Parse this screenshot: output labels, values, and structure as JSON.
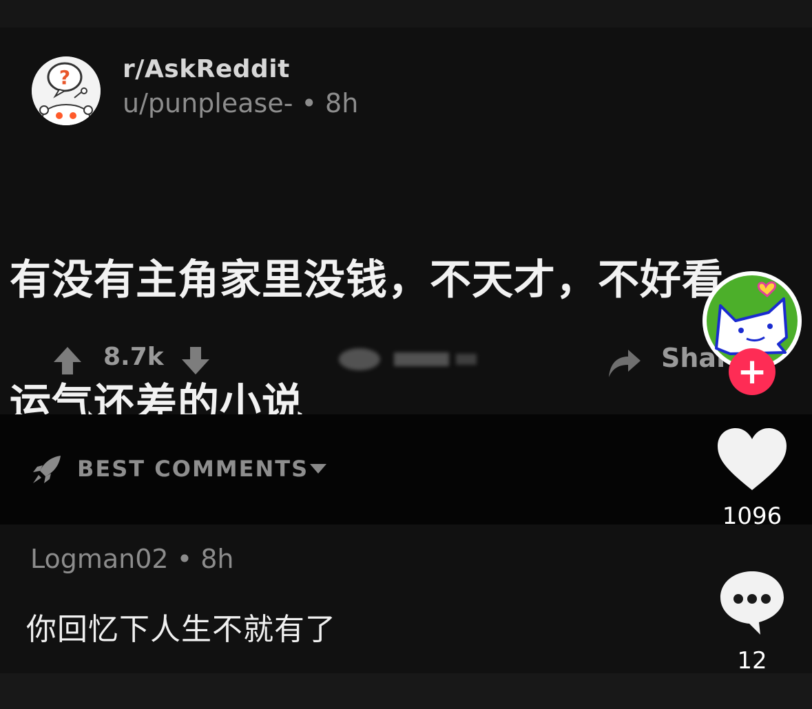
{
  "post": {
    "subreddit": "r/AskReddit",
    "author": "u/punplease-",
    "time": "8h",
    "title_line1": "有没有主角家里没钱，不天才，不好看",
    "title_line2": "运气还差的小说",
    "vote_count": "8.7k",
    "share_label": "Share"
  },
  "sort": {
    "label": "BEST COMMENTS"
  },
  "comment": {
    "author": "Logman02",
    "time": "8h",
    "text": "你回忆下人生不就有了"
  },
  "rail": {
    "like_count": "1096",
    "comment_count": "12",
    "follow_symbol": "+"
  },
  "icons": {
    "subreddit_avatar": "question-snoo-icon",
    "upvote": "arrow-up-icon",
    "downvote": "arrow-down-icon",
    "share": "share-arrow-icon",
    "rocket": "rocket-icon",
    "sort_chevron": "chevron-down-icon",
    "creator_avatar": "cat-avatar-icon",
    "like": "heart-icon",
    "comments": "speech-bubble-icon"
  },
  "colors": {
    "background": "#000000",
    "post_bg": "#101010",
    "follow_red": "#fe2c55",
    "muted_text": "#8d8d8d"
  }
}
